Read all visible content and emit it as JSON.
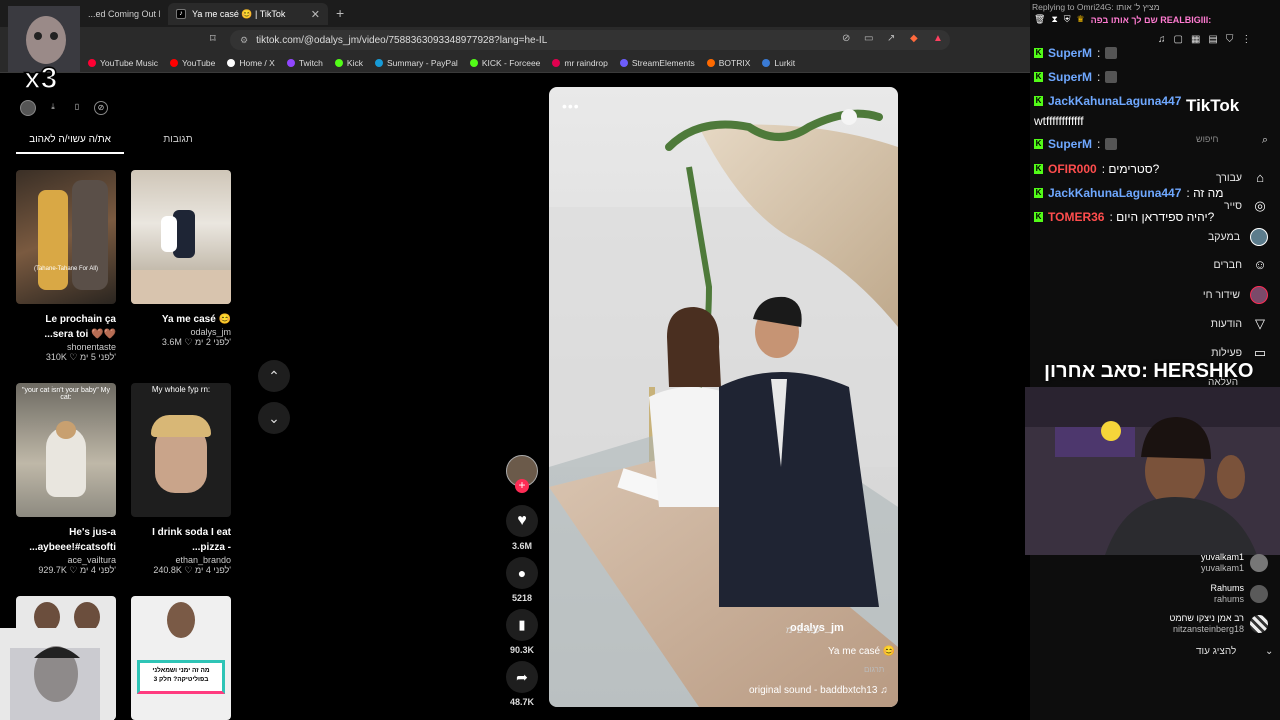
{
  "browser": {
    "tabs": [
      {
        "label": "...ed Coming Out Mome",
        "active": false
      },
      {
        "label": "Ya me casé 😊 | TikTok",
        "active": true
      }
    ],
    "url": "tiktok.com/@odalys_jm/video/7588363093348977928?lang=he-IL",
    "bookmarks": [
      {
        "label": "YouTube Music",
        "color": "#ff0033"
      },
      {
        "label": "YouTube",
        "color": "#ff0000"
      },
      {
        "label": "Home / X",
        "color": "#ffffff"
      },
      {
        "label": "Twitch",
        "color": "#9146ff"
      },
      {
        "label": "Kick",
        "color": "#53fc18"
      },
      {
        "label": "Summary - PayPal",
        "color": "#179bd7"
      },
      {
        "label": "KICK - Forceee",
        "color": "#53fc18"
      },
      {
        "label": "mr raindrop",
        "color": "#e0004f"
      },
      {
        "label": "StreamElements",
        "color": "#6d5dfc"
      },
      {
        "label": "BOTRIX",
        "color": "#ff6a00"
      },
      {
        "label": "Lurkit",
        "color": "#3a7bd5"
      }
    ]
  },
  "profile": {
    "tabs": [
      {
        "label": "את/ה עשוי/ה לאהוב",
        "selected": true
      },
      {
        "label": "תגובות",
        "selected": false
      }
    ],
    "cards": [
      {
        "title": "Le prochain ça ...sera toi 🤎🤎",
        "user": "shonentaste",
        "meta": "310K ♡  לפני 5 ימ'",
        "thumb_caption": "(Tahane-Tahane For All)",
        "bg": "#5a4a3a"
      },
      {
        "title": "Ya me casé 😊",
        "user": "odalys_jm",
        "meta": "3.6M ♡  לפני 2 ימ'",
        "thumb_caption": "",
        "bg": "#d8d2c6"
      },
      {
        "title": "He's jus-a ...aybeee!#catsofti",
        "user": "ace_vailtura",
        "meta": "929.7K ♡  לפני 4 ימ'",
        "thumb_caption": "\"your cat isn't your baby\" My cat:",
        "bg": "#8d8a80"
      },
      {
        "title": "I drink soda I eat ...pizza -",
        "user": "ethan_brando",
        "meta": "240.8K ♡  לפני 4 ימ'",
        "thumb_caption": "My whole fyp rn:",
        "bg": "#2b2b2b"
      },
      {
        "title": "",
        "user": "",
        "meta": "",
        "thumb_caption": "",
        "bg": "#e8e8e8"
      },
      {
        "title": "",
        "user": "",
        "meta": "",
        "thumb_caption": "מה זה ימני ושמאלני בפוליטיקה? חלק 3",
        "bg": "#f2f2f2"
      }
    ]
  },
  "video": {
    "username": "odalys_jm",
    "time": "לפני 2 ימ'",
    "caption": "Ya me casé 😊",
    "translate": "תרגום",
    "sound": "original sound - baddbxtch13 ♫",
    "actions": [
      {
        "name": "like",
        "icon": "♥",
        "count": "3.6M"
      },
      {
        "name": "comment",
        "icon": "…",
        "count": "5218"
      },
      {
        "name": "bookmark",
        "icon": "▮",
        "count": "90.3K"
      },
      {
        "name": "share",
        "icon": "➦",
        "count": "48.7K"
      }
    ]
  },
  "chat": {
    "reply_banner": "Replying to Omri24G: מציץ ל' אותו",
    "pinned": "שם לך אותו בפה REALBIGIII:",
    "lines": [
      {
        "user": "SuperM",
        "color": "#6fa8ff",
        "text": ":",
        "avatar": true
      },
      {
        "user": "SuperM",
        "color": "#6fa8ff",
        "text": ":",
        "avatar": true
      },
      {
        "user": "JackKahunaLaguna447",
        "color": "#6fa8ff",
        "text": ":",
        "avatar": false
      },
      {
        "user": "",
        "color": "#ffffff",
        "text": "wtffffffffffff",
        "avatar": false
      },
      {
        "user": "SuperM",
        "color": "#6fa8ff",
        "text": ":",
        "avatar": true
      },
      {
        "user": "OFIR000",
        "color": "#ff4d4d",
        "text": ": סטרימים?",
        "avatar": false
      },
      {
        "user": "JackKahunaLaguna447",
        "color": "#6fa8ff",
        "text": ": מה זה",
        "avatar": false
      },
      {
        "user": "TOMER36",
        "color": "#ff4d4d",
        "text": ": יהיה ספידראן היום?",
        "avatar": false
      }
    ]
  },
  "sidebar": {
    "logo": "TikTok",
    "search_placeholder": "חיפוש",
    "items": [
      {
        "label": "עבורך",
        "icon": "⌂"
      },
      {
        "label": "סייר",
        "icon": "◎"
      },
      {
        "label": "במעקב",
        "icon": "●"
      },
      {
        "label": "חברים",
        "icon": "☺"
      },
      {
        "label": "שידור חי",
        "icon": "●"
      },
      {
        "label": "הודעות",
        "icon": "▽"
      },
      {
        "label": "פעילות",
        "icon": "▭"
      }
    ],
    "upload_label": "העלאה",
    "sub_banner": "סאב אחרון: HERSHKO",
    "follows": [
      {
        "name": "yuvalkam1",
        "handle": "yuvalkam1"
      },
      {
        "name": "Rahums",
        "handle": "rahums"
      },
      {
        "name": "רב אמן ניצקו שחמט",
        "handle": "nitzansteinberg18"
      }
    ],
    "show_more": "להציג עוד",
    "multiplier": "x3"
  }
}
